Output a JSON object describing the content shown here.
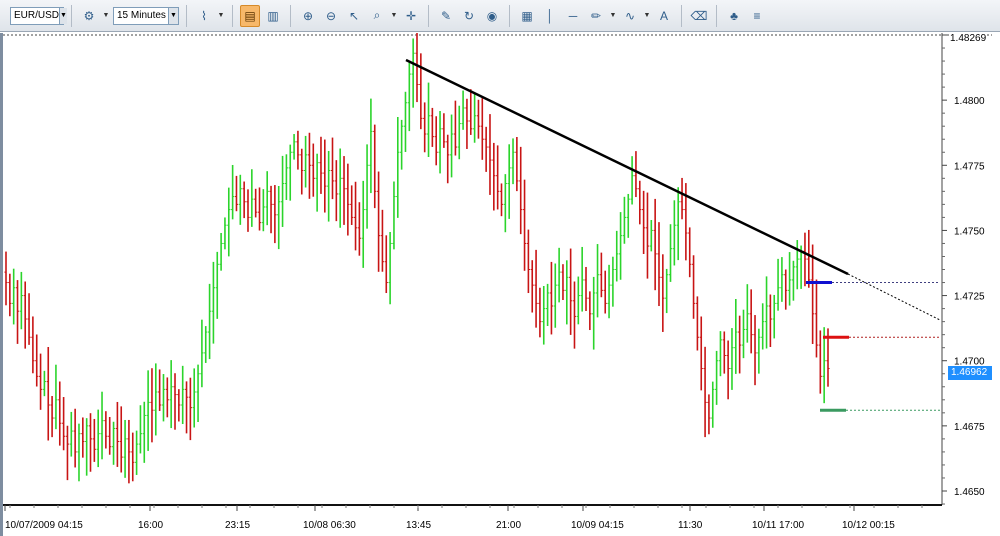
{
  "toolbar": {
    "symbol": "EUR/USD",
    "timeframe": "15 Minutes",
    "buttons": [
      {
        "name": "symbol-picker-icon",
        "glyph": "⚙"
      },
      {
        "name": "chart-type-icon",
        "glyph": "⌇"
      },
      {
        "name": "single-chart-icon",
        "glyph": "▤"
      },
      {
        "name": "multi-chart-icon",
        "glyph": "▥"
      },
      {
        "name": "zoom-in-icon",
        "glyph": "⊕"
      },
      {
        "name": "zoom-out-icon",
        "glyph": "⊖"
      },
      {
        "name": "pointer-icon",
        "glyph": "↖"
      },
      {
        "name": "magnifier-icon",
        "glyph": "🔍"
      },
      {
        "name": "crosshair-icon",
        "glyph": "✛"
      },
      {
        "name": "note-icon",
        "glyph": "✎"
      },
      {
        "name": "refresh-icon",
        "glyph": "↻"
      },
      {
        "name": "globe-icon",
        "glyph": "◉"
      },
      {
        "name": "picture-icon",
        "glyph": "▦"
      },
      {
        "name": "vertical-line-icon",
        "glyph": "│"
      },
      {
        "name": "horizontal-line-icon",
        "glyph": "─"
      },
      {
        "name": "pencil-icon",
        "glyph": "✏"
      },
      {
        "name": "indicator-icon",
        "glyph": "∿"
      },
      {
        "name": "text-icon",
        "glyph": "A"
      },
      {
        "name": "eraser-icon",
        "glyph": "⌫"
      },
      {
        "name": "tree-icon",
        "glyph": "♣"
      },
      {
        "name": "menu-icon",
        "glyph": "≡"
      }
    ]
  },
  "chart_data": {
    "type": "candlestick",
    "symbol": "EUR/USD",
    "timeframe": "15 Minutes",
    "ylim": [
      1.6443,
      1.4827
    ],
    "y_ticks": [
      "1.4825",
      "1.4800",
      "1.4775",
      "1.4750",
      "1.4725",
      "1.4700",
      "1.4675",
      "1.4650"
    ],
    "top_price_label": "1.48269",
    "last_price": "1.46962",
    "x_tick_labels": [
      "10/07/2009 04:15",
      "16:00",
      "23:15",
      "10/08 06:30",
      "13:45",
      "21:00",
      "10/09 04:15",
      "11:30",
      "10/11 17:00",
      "10/12 00:15"
    ],
    "trendline": {
      "from": [
        1.4818
      ],
      "to": [
        1.4733
      ]
    },
    "horizontal_levels": [
      {
        "price": 1.473,
        "color": "#1010d0",
        "label": "blue level"
      },
      {
        "price": 1.4709,
        "color": "#dd1111",
        "label": "red level"
      },
      {
        "price": 1.4681,
        "color": "#3a9a60",
        "label": "green level"
      }
    ],
    "colors": {
      "up": "#2bd42b",
      "down": "#c81414",
      "trend": "#000000",
      "last_price_bg": "#1f8fff"
    },
    "closes": [
      1.473,
      1.4722,
      1.4728,
      1.4719,
      1.4725,
      1.4716,
      1.4709,
      1.47,
      1.4694,
      1.4689,
      1.4692,
      1.4683,
      1.4678,
      1.4685,
      1.4676,
      1.4671,
      1.4668,
      1.4673,
      1.4665,
      1.4672,
      1.4669,
      1.4675,
      1.467,
      1.4666,
      1.4672,
      1.4677,
      1.4671,
      1.4667,
      1.4674,
      1.4669,
      1.4663,
      1.467,
      1.4665,
      1.4661,
      1.4668,
      1.4672,
      1.4679,
      1.4684,
      1.4681,
      1.4688,
      1.4683,
      1.4689,
      1.4685,
      1.469,
      1.4687,
      1.4683,
      1.4689,
      1.4686,
      1.4682,
      1.4688,
      1.4695,
      1.4703,
      1.4711,
      1.4719,
      1.4728,
      1.4737,
      1.4745,
      1.4752,
      1.4758,
      1.4763,
      1.476,
      1.4766,
      1.4761,
      1.4755,
      1.4762,
      1.4757,
      1.4753,
      1.4759,
      1.4765,
      1.476,
      1.4756,
      1.4761,
      1.4768,
      1.4774,
      1.478,
      1.4784,
      1.4779,
      1.4773,
      1.4779,
      1.4775,
      1.477,
      1.4776,
      1.4772,
      1.4767,
      1.4773,
      1.4769,
      1.4764,
      1.477,
      1.4766,
      1.476,
      1.4755,
      1.4751,
      1.4747,
      1.4758,
      1.4775,
      1.4788,
      1.4765,
      1.4748,
      1.4738,
      1.473,
      1.4745,
      1.4763,
      1.478,
      1.479,
      1.4799,
      1.481,
      1.4818,
      1.4806,
      1.4793,
      1.4787,
      1.4794,
      1.4786,
      1.478,
      1.4789,
      1.4784,
      1.4779,
      1.4787,
      1.4782,
      1.4791,
      1.4797,
      1.4792,
      1.4789,
      1.4794,
      1.479,
      1.4785,
      1.4782,
      1.4777,
      1.4771,
      1.4765,
      1.476,
      1.4768,
      1.4774,
      1.478,
      1.4769,
      1.4758,
      1.4745,
      1.4735,
      1.4729,
      1.4722,
      1.4715,
      1.472,
      1.4726,
      1.4721,
      1.4729,
      1.4734,
      1.4727,
      1.4732,
      1.4723,
      1.4717,
      1.4725,
      1.4731,
      1.4724,
      1.4718,
      1.4726,
      1.4733,
      1.4727,
      1.4722,
      1.4729,
      1.4735,
      1.4741,
      1.4748,
      1.4755,
      1.4762,
      1.4771,
      1.4766,
      1.4758,
      1.4751,
      1.4744,
      1.475,
      1.4741,
      1.4732,
      1.4724,
      1.4733,
      1.4743,
      1.4752,
      1.4761,
      1.4758,
      1.4749,
      1.4737,
      1.4722,
      1.4709,
      1.4697,
      1.4684,
      1.4678,
      1.4689,
      1.47,
      1.4708,
      1.4702,
      1.4697,
      1.4705,
      1.4711,
      1.4706,
      1.4712,
      1.4718,
      1.471,
      1.4703,
      1.4709,
      1.4715,
      1.4721,
      1.4716,
      1.4722,
      1.4728,
      1.4733,
      1.4727,
      1.4731,
      1.4736,
      1.4739,
      1.4742,
      1.4739,
      1.4731,
      1.4718,
      1.4706,
      1.4694,
      1.47,
      1.4697
    ]
  }
}
